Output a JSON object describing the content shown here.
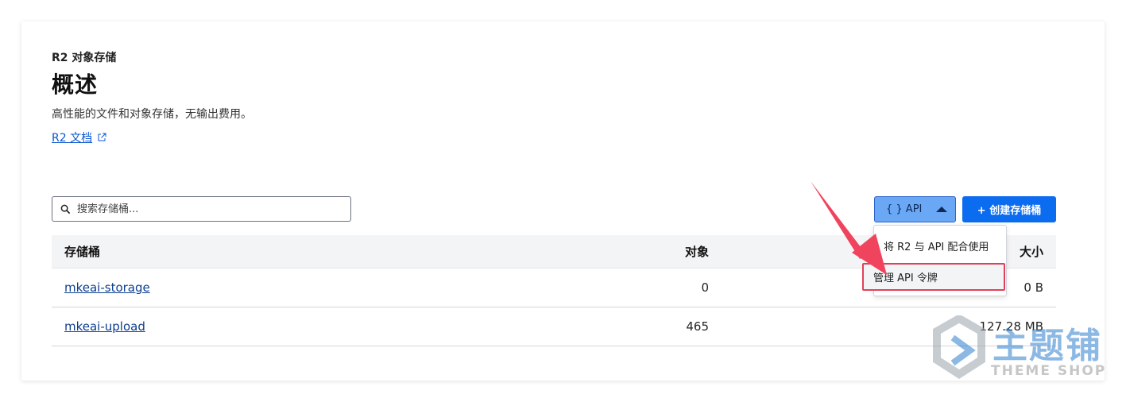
{
  "header": {
    "eyebrow": "R2 对象存储",
    "title": "概述",
    "description": "高性能的文件和对象存储，无输出费用。",
    "docs_link": "R2 文档"
  },
  "toolbar": {
    "search_placeholder": "搜索存储桶...",
    "api_label": "{ } API",
    "create_label": "+ 创建存储桶"
  },
  "api_menu": {
    "items": [
      "将 R2 与 API 配合使用",
      "管理 API 令牌"
    ]
  },
  "table": {
    "headers": [
      "存储桶",
      "对象",
      "大小"
    ],
    "rows": [
      {
        "name": "mkeai-storage",
        "objects": "0",
        "size": "0 B"
      },
      {
        "name": "mkeai-upload",
        "objects": "465",
        "size": "127.28 MB"
      }
    ]
  },
  "watermark": {
    "title": "主题铺",
    "subtitle": "THEME SHOP"
  },
  "colors": {
    "primary": "#0b6cf0",
    "api_button": "#6aa7f5",
    "highlight": "#e0415a",
    "link": "#0b3d91"
  }
}
